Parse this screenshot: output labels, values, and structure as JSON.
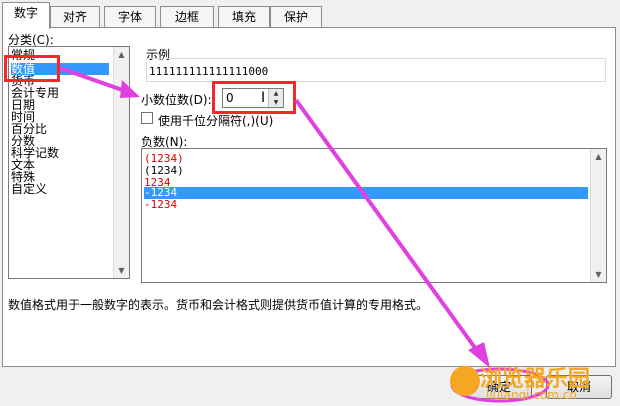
{
  "tabs": [
    "数字",
    "对齐",
    "字体",
    "边框",
    "填充",
    "保护"
  ],
  "category": {
    "label": "分类(C):",
    "items": [
      "常规",
      "数值",
      "货币",
      "会计专用",
      "日期",
      "时间",
      "百分比",
      "分数",
      "科学记数",
      "文本",
      "特殊",
      "自定义"
    ],
    "selected": "数值"
  },
  "sample": {
    "label": "示例",
    "value": "111111111111111000"
  },
  "decimal": {
    "label": "小数位数(D):",
    "value": "0"
  },
  "thousands": {
    "label": "使用千位分隔符(,)(U)",
    "checked": false
  },
  "negatives": {
    "label": "负数(N):",
    "items": [
      {
        "text": "(1234)",
        "color": "#e00000"
      },
      {
        "text": "(1234)",
        "color": "#000000"
      },
      {
        "text": "1234",
        "color": "#e00000"
      },
      {
        "text": "-1234",
        "color": "#000000",
        "selected": true
      },
      {
        "text": "-1234",
        "color": "#e00000"
      }
    ]
  },
  "description": "数值格式用于一般数字的表示。货币和会计格式则提供货币值计算的专用格式。",
  "buttons": {
    "ok": "确定",
    "cancel": "取消"
  },
  "watermark": {
    "title": "浏览器乐园",
    "url": "liulanqi.com.cn"
  },
  "colors": {
    "selection": "#3399ff",
    "annotation_box": "#ef2a2a",
    "annotation_arrow": "#e040e0"
  }
}
